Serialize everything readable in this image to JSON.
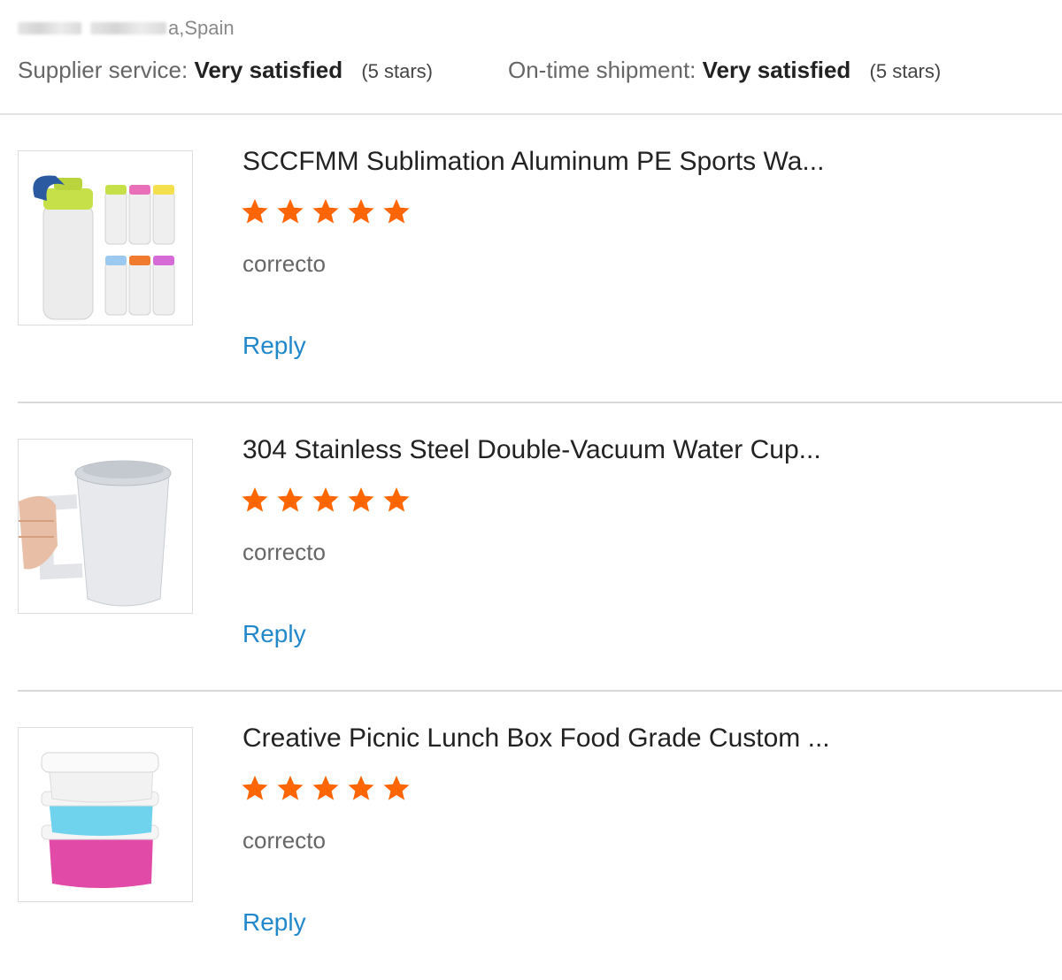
{
  "location": {
    "suffix": "a,Spain"
  },
  "ratings": [
    {
      "label": "Supplier service:",
      "value": "Very satisfied",
      "stars_text": "(5 stars)"
    },
    {
      "label": "On-time shipment:",
      "value": "Very satisfied",
      "stars_text": "(5 stars)"
    }
  ],
  "star_color": "#ff6600",
  "reviews": [
    {
      "title": "SCCFMM Sublimation Aluminum PE Sports Wa...",
      "rating": 5,
      "comment": "correcto",
      "reply_label": "Reply",
      "thumb_icon": "water-bottles-image"
    },
    {
      "title": "304 Stainless Steel Double-Vacuum Water Cup...",
      "rating": 5,
      "comment": "correcto",
      "reply_label": "Reply",
      "thumb_icon": "steel-mug-image"
    },
    {
      "title": "Creative Picnic Lunch Box Food Grade Custom ...",
      "rating": 5,
      "comment": "correcto",
      "reply_label": "Reply",
      "thumb_icon": "lunch-box-image"
    }
  ]
}
